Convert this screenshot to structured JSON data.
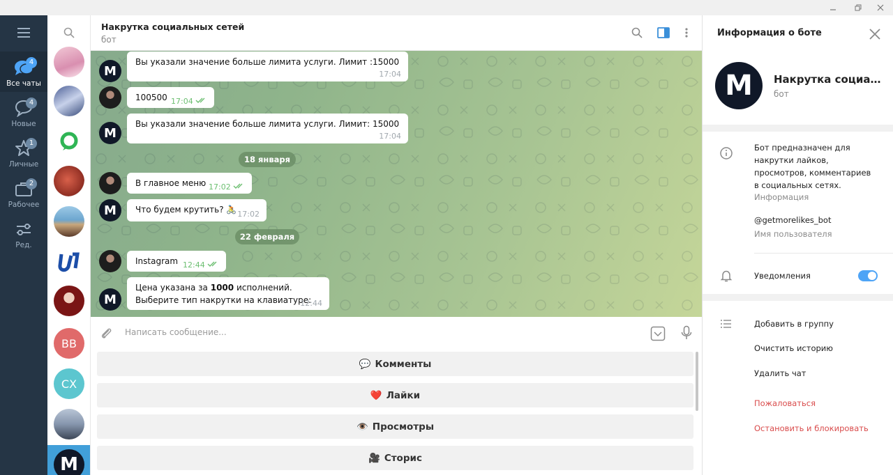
{
  "folders": [
    {
      "label": "Все чаты",
      "badge": "4",
      "icon": "chats-icon",
      "active": true
    },
    {
      "label": "Новые",
      "badge": "4",
      "icon": "chat-bubble-icon",
      "active": false
    },
    {
      "label": "Личные",
      "badge": "1",
      "icon": "star-icon",
      "active": false
    },
    {
      "label": "Рабочее",
      "badge": "2",
      "icon": "briefcase-icon",
      "active": false
    },
    {
      "label": "Ред.",
      "badge": "",
      "icon": "sliders-icon",
      "active": false
    }
  ],
  "chatlist": {
    "initials": [
      "BB",
      "CX"
    ],
    "active_letter": "M",
    "colors": {
      "bb": "#e06a6a",
      "cx": "#5cc6cf",
      "active": "#419fd9"
    }
  },
  "chat": {
    "title": "Накрутка социальных сетей",
    "subtitle": "бот",
    "bot_letter": "M",
    "messages": [
      {
        "text": "Вы указали значение больше лимита услуги. Лимит :15000",
        "time": "17:04"
      },
      {
        "text": "100500",
        "time": "17:04"
      },
      {
        "text": "Вы указали значение больше лимита услуги. Лимит: 15000",
        "time": "17:04"
      },
      {
        "text": "В главное меню",
        "time": "17:02"
      },
      {
        "text": "Что будем крутить? 🚴",
        "time": "17:02"
      },
      {
        "text": "Instagram",
        "time": "12:44"
      },
      {
        "line1_pre": "Цена указана за ",
        "line1_bold": "1000",
        "line1_post": " исполнений.",
        "line2": "Выберите тип накрутки на клавиатуре:",
        "time": "12:44"
      }
    ],
    "dates": [
      "18 января",
      "22 февраля"
    ],
    "composer_placeholder": "Написать сообщение...",
    "keyboard": [
      {
        "emoji": "💬",
        "label": "Комменты"
      },
      {
        "emoji": "❤️",
        "label": "Лайки"
      },
      {
        "emoji": "👁️",
        "label": "Просмотры"
      },
      {
        "emoji": "🎥",
        "label": "Сторис"
      }
    ]
  },
  "info": {
    "title": "Информация о боте",
    "name": "Накрутка социальных сетей",
    "subtitle": "бот",
    "avatar_letter": "M",
    "description": [
      "Бот предназначен для",
      "накрутки лайков,",
      "просмотров, комментариев",
      "в социальных сетях."
    ],
    "description_hint": "Информация",
    "username": "@getmorelikes_bot",
    "username_hint": "Имя пользователя",
    "notifications_label": "Уведомления",
    "notifications_on": true,
    "actions": [
      "Добавить в группу",
      "Очистить историю",
      "Удалить чат"
    ],
    "danger_actions": [
      "Пожаловаться",
      "Остановить и блокировать"
    ]
  },
  "colors": {
    "accent": "#4ea4f6",
    "sidebar": "#253545",
    "out_time": "#6cbf71",
    "danger": "#d94c4c"
  }
}
